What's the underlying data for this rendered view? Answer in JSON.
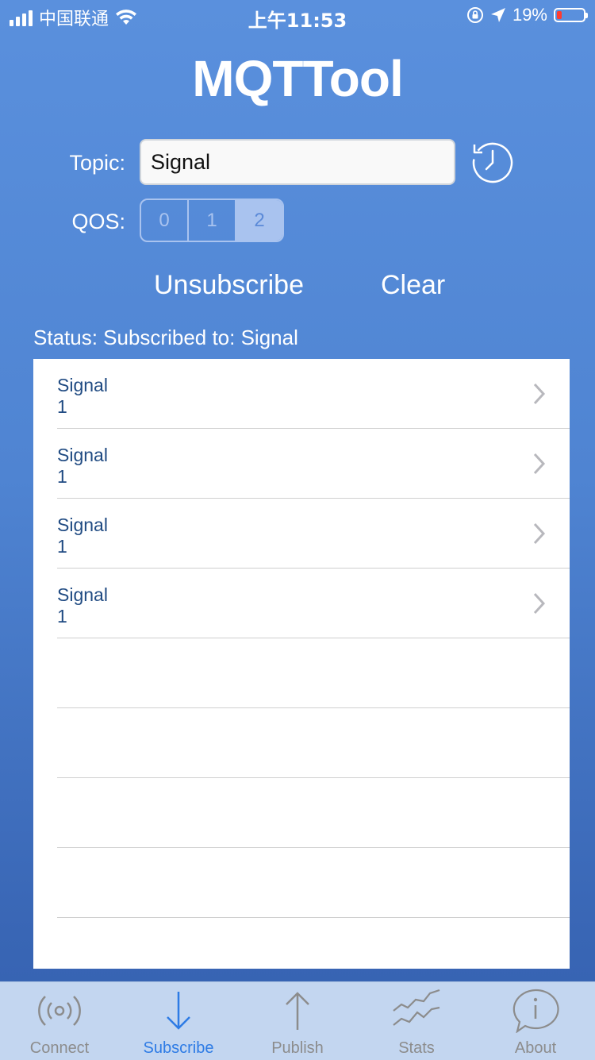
{
  "status_bar": {
    "carrier": "中国联通",
    "time": "上午11:53",
    "battery": "19%",
    "battery_level": 0.19,
    "icons": [
      "signal-bars-icon",
      "wifi-icon",
      "orientation-lock-icon",
      "location-arrow-icon",
      "battery-icon"
    ]
  },
  "app": {
    "title": "MQTTool"
  },
  "form": {
    "topic_label": "Topic:",
    "topic_value": "Signal",
    "history_icon": "history-clock-icon",
    "qos_label": "QOS:",
    "qos_options": [
      "0",
      "1",
      "2"
    ],
    "qos_selected": "2"
  },
  "actions": {
    "unsubscribe": "Unsubscribe",
    "clear": "Clear"
  },
  "status": "Status: Subscribed to: Signal",
  "messages": [
    {
      "topic": "Signal",
      "payload": "1"
    },
    {
      "topic": "Signal",
      "payload": "1"
    },
    {
      "topic": "Signal",
      "payload": "1"
    },
    {
      "topic": "Signal",
      "payload": "1"
    }
  ],
  "tabs": [
    {
      "label": "Connect",
      "icon": "broadcast-icon"
    },
    {
      "label": "Subscribe",
      "icon": "arrow-down-icon"
    },
    {
      "label": "Publish",
      "icon": "arrow-up-icon"
    },
    {
      "label": "Stats",
      "icon": "stats-chart-icon"
    },
    {
      "label": "About",
      "icon": "info-bubble-icon"
    }
  ],
  "active_tab": "Subscribe",
  "colors": {
    "accent": "#2d7be5",
    "inactive": "#8c8c8c",
    "tabbar": "#c3d6f0",
    "segment": "#a9c3ef",
    "battery_low": "#ff3b30"
  }
}
